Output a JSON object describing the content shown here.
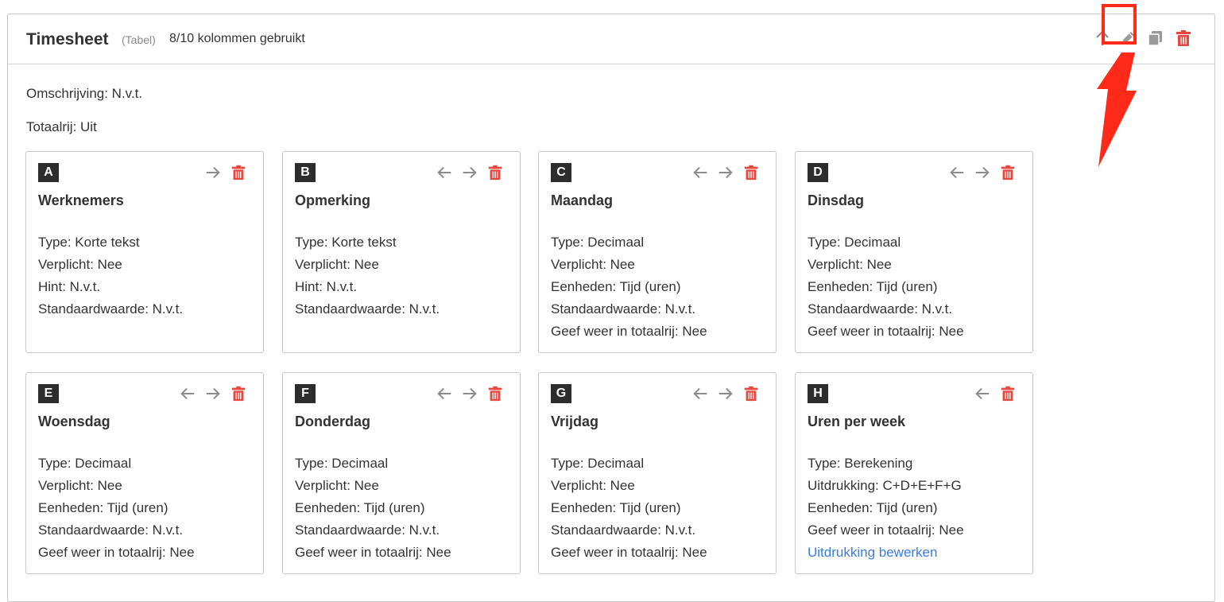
{
  "header": {
    "title": "Timesheet",
    "type_label": "(Tabel)",
    "usage": "8/10 kolommen gebruikt",
    "actions": [
      "move-up",
      "edit",
      "copy",
      "delete"
    ]
  },
  "meta": {
    "description": "Omschrijving: N.v.t.",
    "total_row": "Totaalrij: Uit"
  },
  "columns": [
    {
      "letter": "A",
      "title": "Werknemers",
      "lines": [
        "Type: Korte tekst",
        "Verplicht: Nee",
        "Hint: N.v.t.",
        "Standaardwaarde: N.v.t.",
        ""
      ],
      "link": ""
    },
    {
      "letter": "B",
      "title": "Opmerking",
      "lines": [
        "Type: Korte tekst",
        "Verplicht: Nee",
        "Hint: N.v.t.",
        "Standaardwaarde: N.v.t.",
        ""
      ],
      "link": ""
    },
    {
      "letter": "C",
      "title": "Maandag",
      "lines": [
        "Type: Decimaal",
        "Verplicht: Nee",
        "Eenheden: Tijd (uren)",
        "Standaardwaarde: N.v.t.",
        "Geef weer in totaalrij: Nee"
      ],
      "link": ""
    },
    {
      "letter": "D",
      "title": "Dinsdag",
      "lines": [
        "Type: Decimaal",
        "Verplicht: Nee",
        "Eenheden: Tijd (uren)",
        "Standaardwaarde: N.v.t.",
        "Geef weer in totaalrij: Nee"
      ],
      "link": ""
    },
    {
      "letter": "E",
      "title": "Woensdag",
      "lines": [
        "Type: Decimaal",
        "Verplicht: Nee",
        "Eenheden: Tijd (uren)",
        "Standaardwaarde: N.v.t.",
        "Geef weer in totaalrij: Nee"
      ],
      "link": ""
    },
    {
      "letter": "F",
      "title": "Donderdag",
      "lines": [
        "Type: Decimaal",
        "Verplicht: Nee",
        "Eenheden: Tijd (uren)",
        "Standaardwaarde: N.v.t.",
        "Geef weer in totaalrij: Nee"
      ],
      "link": ""
    },
    {
      "letter": "G",
      "title": "Vrijdag",
      "lines": [
        "Type: Decimaal",
        "Verplicht: Nee",
        "Eenheden: Tijd (uren)",
        "Standaardwaarde: N.v.t.",
        "Geef weer in totaalrij: Nee"
      ],
      "link": ""
    },
    {
      "letter": "H",
      "title": "Uren per week",
      "lines": [
        "Type: Berekening",
        "Uitdrukking: C+D+E+F+G",
        "Eenheden: Tijd (uren)",
        "Geef weer in totaalrij: Nee",
        ""
      ],
      "link": "Uitdrukking bewerken"
    }
  ],
  "colors": {
    "delete": "#e8473f",
    "arrows": "#8c8c8c",
    "highlight": "#ff2a1a",
    "link": "#3b7ddd",
    "badge": "#2d2d2d"
  }
}
